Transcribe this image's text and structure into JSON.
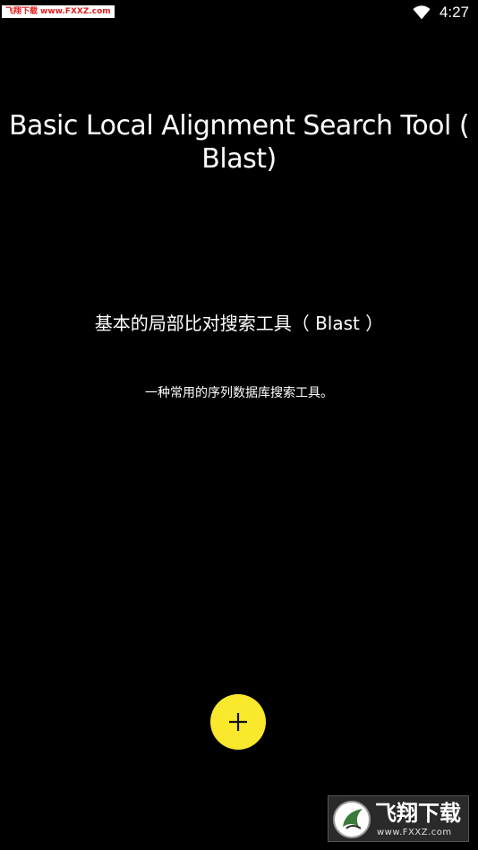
{
  "status_bar": {
    "time": "4:27",
    "watermark_cn": "飞翔下载",
    "watermark_url": "www.FXXZ.com"
  },
  "main": {
    "title": "Basic Local Alignment Search Tool ( Blast)",
    "subtitle_cn": "基本的局部比对搜索工具（ Blast ）",
    "description_cn": "一种常用的序列数据库搜索工具。"
  },
  "fab": {
    "icon": "plus-icon",
    "color": "#f9e82b"
  },
  "watermark_bottom": {
    "cn": "飞翔下载",
    "url": "www.FXXZ.com"
  }
}
